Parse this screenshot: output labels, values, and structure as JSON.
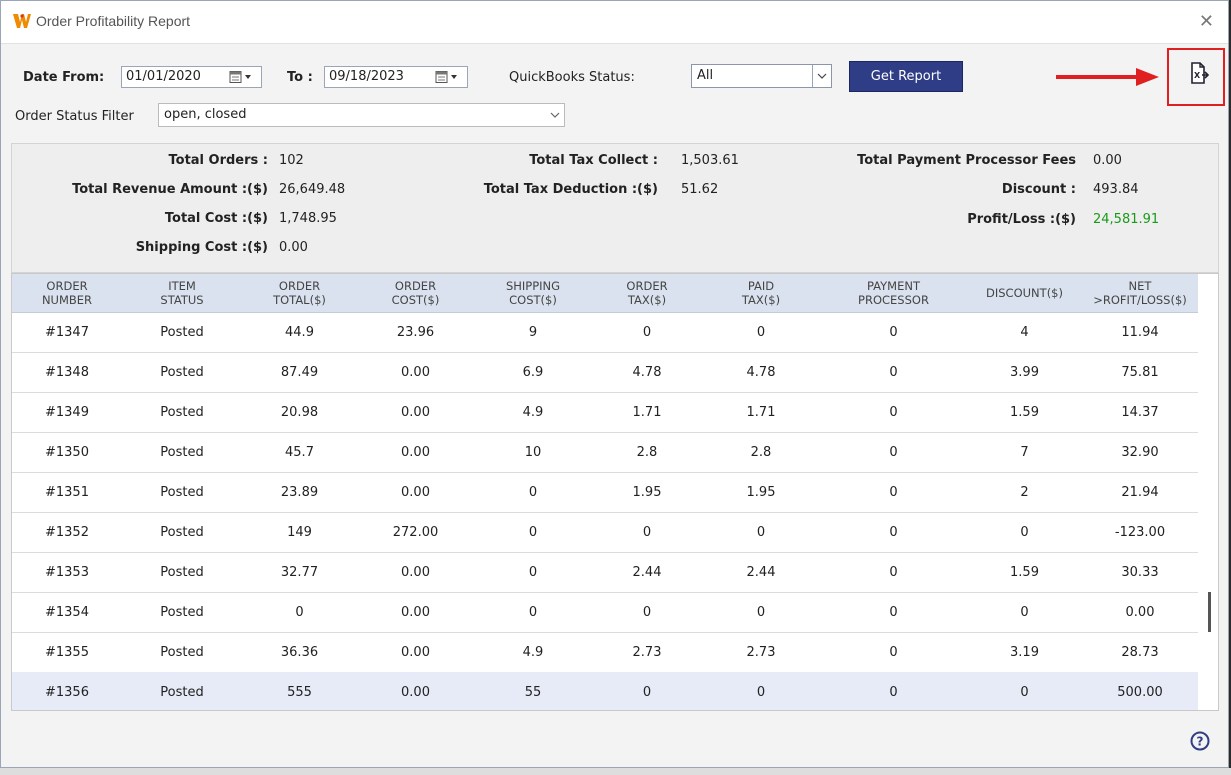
{
  "window": {
    "title": "Order Profitability Report"
  },
  "filters": {
    "date_from_label": "Date From:",
    "date_from": "01/01/2020",
    "to_label": "To :",
    "date_to": "09/18/2023",
    "qb_status_label": "QuickBooks Status:",
    "qb_status": "All",
    "order_status_label": "Order Status Filter",
    "order_status": "open, closed",
    "get_report": "Get Report"
  },
  "summary": {
    "total_orders_label": "Total Orders :",
    "total_orders": "102",
    "total_revenue_label": "Total Revenue Amount :($)",
    "total_revenue": "26,649.48",
    "total_cost_label": "Total Cost :($)",
    "total_cost": "1,748.95",
    "shipping_cost_label": "Shipping Cost :($)",
    "shipping_cost": "0.00",
    "tax_collect_label": "Total Tax Collect :",
    "tax_collect": "1,503.61",
    "tax_deduction_label": "Total Tax Deduction :($)",
    "tax_deduction": "51.62",
    "processor_fees_label": "Total Payment Processor Fees",
    "processor_fees": "0.00",
    "discount_label": "Discount :",
    "discount": "493.84",
    "profit_loss_label": "Profit/Loss :($)",
    "profit_loss": "24,581.91",
    "profit_color": "#1a9a1a"
  },
  "table": {
    "headers": [
      "ORDER\nNUMBER",
      "ITEM\nSTATUS",
      "ORDER\nTOTAL($)",
      "ORDER\nCOST($)",
      "SHIPPING\nCOST($)",
      "ORDER\nTAX($)",
      "PAID\nTAX($)",
      "PAYMENT\nPROCESSOR",
      "DISCOUNT($)",
      "NET\n>ROFIT/LOSS($)"
    ],
    "rows": [
      [
        "#1347",
        "Posted",
        "44.9",
        "23.96",
        "9",
        "0",
        "0",
        "0",
        "4",
        "11.94"
      ],
      [
        "#1348",
        "Posted",
        "87.49",
        "0.00",
        "6.9",
        "4.78",
        "4.78",
        "0",
        "3.99",
        "75.81"
      ],
      [
        "#1349",
        "Posted",
        "20.98",
        "0.00",
        "4.9",
        "1.71",
        "1.71",
        "0",
        "1.59",
        "14.37"
      ],
      [
        "#1350",
        "Posted",
        "45.7",
        "0.00",
        "10",
        "2.8",
        "2.8",
        "0",
        "7",
        "32.90"
      ],
      [
        "#1351",
        "Posted",
        "23.89",
        "0.00",
        "0",
        "1.95",
        "1.95",
        "0",
        "2",
        "21.94"
      ],
      [
        "#1352",
        "Posted",
        "149",
        "272.00",
        "0",
        "0",
        "0",
        "0",
        "0",
        "-123.00"
      ],
      [
        "#1353",
        "Posted",
        "32.77",
        "0.00",
        "0",
        "2.44",
        "2.44",
        "0",
        "1.59",
        "30.33"
      ],
      [
        "#1354",
        "Posted",
        "0",
        "0.00",
        "0",
        "0",
        "0",
        "0",
        "0",
        "0.00"
      ],
      [
        "#1355",
        "Posted",
        "36.36",
        "0.00",
        "4.9",
        "2.73",
        "2.73",
        "0",
        "3.19",
        "28.73"
      ],
      [
        "#1356",
        "Posted",
        "555",
        "0.00",
        "55",
        "0",
        "0",
        "0",
        "0",
        "500.00"
      ]
    ],
    "selected_row": 9
  },
  "icons": {
    "logo": "app-logo-icon",
    "export": "export-excel-icon",
    "help": "help-icon",
    "accent": "#2f3c86",
    "highlight": "#e02020"
  }
}
